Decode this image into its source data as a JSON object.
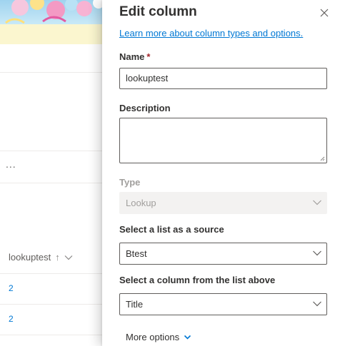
{
  "background_list": {
    "ellipsis": "...",
    "column_header": "lookuptest",
    "sort_arrow": "↑",
    "rows": [
      "2",
      "2"
    ]
  },
  "panel": {
    "title": "Edit column",
    "learn_more": "Learn more about column types and options.",
    "name": {
      "label": "Name",
      "required_mark": "*",
      "value": "lookuptest"
    },
    "description": {
      "label": "Description",
      "value": ""
    },
    "type": {
      "label": "Type",
      "value": "Lookup"
    },
    "source_list": {
      "label": "Select a list as a source",
      "value": "Btest"
    },
    "source_column": {
      "label": "Select a column from the list above",
      "value": "Title"
    },
    "more_options": "More options"
  },
  "colors": {
    "accent": "#0078d4",
    "required": "#a4262c",
    "disabled_text": "#a19f9d",
    "notice_bar": "#fbf6cf"
  },
  "icons": {
    "close": "close-icon",
    "dropdown": "chevron-down-icon",
    "sort": "sort-ascending-icon"
  }
}
